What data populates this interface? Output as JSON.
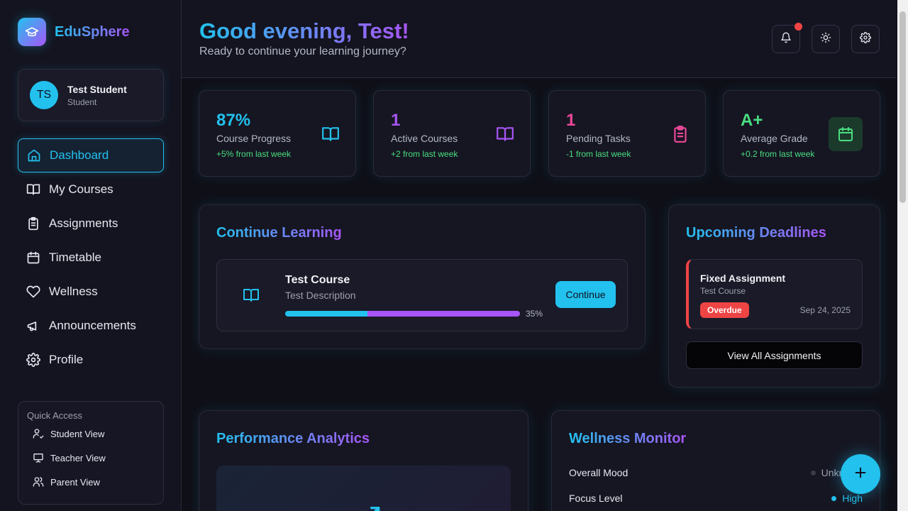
{
  "app": {
    "name": "EduSphere"
  },
  "user": {
    "initials": "TS",
    "name": "Test Student",
    "role": "Student"
  },
  "nav": [
    {
      "label": "Dashboard",
      "icon": "home-icon",
      "active": true
    },
    {
      "label": "My Courses",
      "icon": "book-icon"
    },
    {
      "label": "Assignments",
      "icon": "clipboard-icon"
    },
    {
      "label": "Timetable",
      "icon": "calendar-icon"
    },
    {
      "label": "Wellness",
      "icon": "heart-icon"
    },
    {
      "label": "Announcements",
      "icon": "megaphone-icon"
    },
    {
      "label": "Profile",
      "icon": "gear-icon"
    }
  ],
  "quick_access": {
    "title": "Quick Access",
    "items": [
      {
        "label": "Student View",
        "icon": "user-check-icon"
      },
      {
        "label": "Teacher View",
        "icon": "presentation-icon"
      },
      {
        "label": "Parent View",
        "icon": "users-icon"
      }
    ]
  },
  "header": {
    "greeting": "Good evening, Test!",
    "subtitle": "Ready to continue your learning journey?"
  },
  "stats": [
    {
      "value": "87%",
      "label": "Course Progress",
      "delta": "+5% from last week",
      "color": "#22c1ee",
      "icon": "book-icon"
    },
    {
      "value": "1",
      "label": "Active Courses",
      "delta": "+2 from last week",
      "color": "#a855f7",
      "icon": "book-icon"
    },
    {
      "value": "1",
      "label": "Pending Tasks",
      "delta": "-1 from last week",
      "color": "#ec4899",
      "icon": "clipboard-icon"
    },
    {
      "value": "A+",
      "label": "Average Grade",
      "delta": "+0.2 from last week",
      "color": "#4ade80",
      "icon": "calendar-icon"
    }
  ],
  "continue_learning": {
    "title": "Continue Learning",
    "course": {
      "name": "Test Course",
      "description": "Test Description",
      "progress": 35,
      "progress_label": "35%",
      "button": "Continue"
    }
  },
  "deadlines": {
    "title": "Upcoming Deadlines",
    "items": [
      {
        "title": "Fixed Assignment",
        "course": "Test Course",
        "status": "Overdue",
        "date": "Sep 24, 2025"
      }
    ],
    "view_all": "View All Assignments"
  },
  "performance": {
    "title": "Performance Analytics"
  },
  "wellness": {
    "title": "Wellness Monitor",
    "rows": [
      {
        "label": "Overall Mood",
        "value": "Unknown",
        "color": "#3a3a4a"
      },
      {
        "label": "Focus Level",
        "value": "High",
        "color": "#22c1ee"
      }
    ]
  },
  "colors": {
    "accent": "#22c1ee",
    "accent2": "#a855f7",
    "danger": "#ef4444",
    "success": "#4ade80"
  }
}
